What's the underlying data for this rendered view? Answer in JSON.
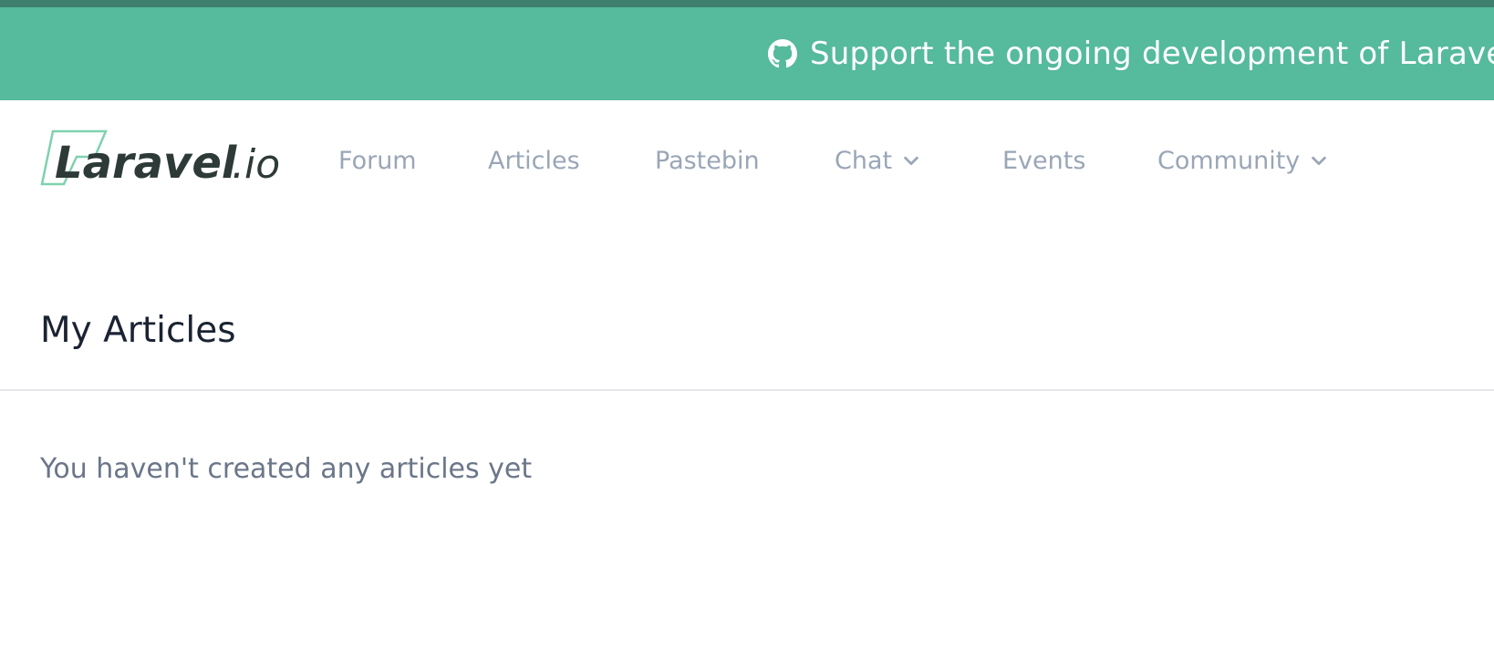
{
  "banner": {
    "text": "Support the ongoing development of Laravel.io",
    "icon": "github-icon"
  },
  "logo": {
    "name": "Laravel.io",
    "main": "Laravel",
    "suffix": ".io",
    "accent_color": "#7fd1ad"
  },
  "nav": {
    "forum": "Forum",
    "articles": "Articles",
    "pastebin": "Pastebin",
    "chat": "Chat",
    "events": "Events",
    "community": "Community"
  },
  "main": {
    "title": "My Articles",
    "empty_message": "You haven't created any articles yet"
  },
  "colors": {
    "banner_bg": "#56ba9c",
    "topline": "#3e806d",
    "nav_text": "#9aa6b7",
    "title_text": "#1b2333",
    "muted_text": "#6b7689"
  }
}
